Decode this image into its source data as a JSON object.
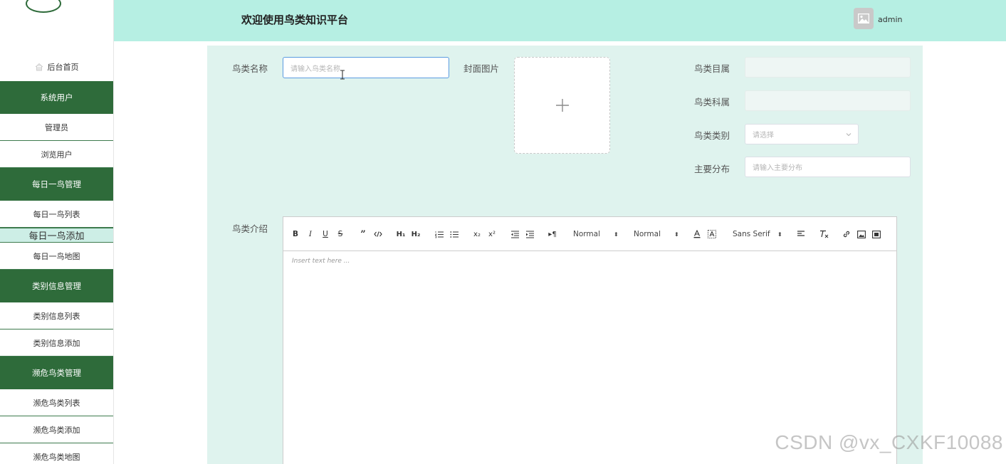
{
  "header": {
    "title": "欢迎使用鸟类知识平台",
    "username": "admin"
  },
  "sidebar": {
    "items": [
      {
        "label": "后台首页",
        "type": "home"
      },
      {
        "label": "系统用户",
        "type": "group"
      },
      {
        "label": "管理员",
        "type": "sub"
      },
      {
        "label": "浏览用户",
        "type": "sub"
      },
      {
        "label": "每日一鸟管理",
        "type": "group"
      },
      {
        "label": "每日一鸟列表",
        "type": "sub"
      },
      {
        "label": "每日一鸟添加",
        "type": "active"
      },
      {
        "label": "每日一鸟地图",
        "type": "sub"
      },
      {
        "label": "类别信息管理",
        "type": "group"
      },
      {
        "label": "类别信息列表",
        "type": "sub"
      },
      {
        "label": "类别信息添加",
        "type": "sub"
      },
      {
        "label": "濒危鸟类管理",
        "type": "group"
      },
      {
        "label": "濒危鸟类列表",
        "type": "sub"
      },
      {
        "label": "濒危鸟类添加",
        "type": "sub"
      },
      {
        "label": "濒危鸟类地图",
        "type": "sub"
      }
    ]
  },
  "form": {
    "name_label": "鸟类名称",
    "name_placeholder": "请输入鸟类名称",
    "cover_label": "封面图片",
    "order_label": "鸟类目属",
    "family_label": "鸟类科属",
    "category_label": "鸟类类别",
    "category_placeholder": "请选择",
    "distribution_label": "主要分布",
    "distribution_placeholder": "请输入主要分布",
    "intro_label": "鸟类介绍"
  },
  "editor": {
    "header_pick": "Normal",
    "size_pick": "Normal",
    "font_pick": "Sans Serif",
    "placeholder": "Insert text here ..."
  },
  "watermark": "CSDN @vx_CXKF10088"
}
